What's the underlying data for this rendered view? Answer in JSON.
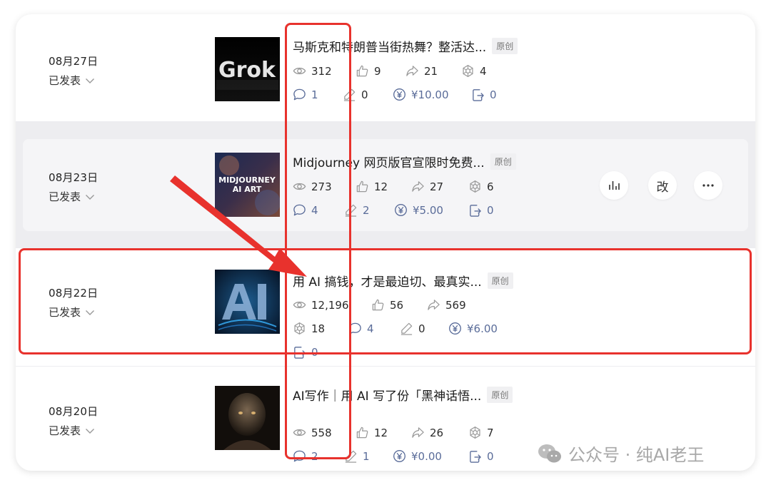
{
  "articles": [
    {
      "date": "08月27日",
      "status": "已发表",
      "title": "马斯克和特朗普当街热舞？整活达...",
      "tag": "原创",
      "thumb_text": "Grok",
      "reads": "312",
      "likes": "9",
      "shares": "21",
      "recommends": "4",
      "comments": "1",
      "notes": "0",
      "earnings": "¥10.00",
      "jumps": "0"
    },
    {
      "date": "08月23日",
      "status": "已发表",
      "title": "Midjourney 网页版官宣限时免费...",
      "tag": "原创",
      "thumb_text_1": "MIDJOURNEY",
      "thumb_text_2": "AI ART",
      "reads": "273",
      "likes": "12",
      "shares": "27",
      "recommends": "6",
      "comments": "4",
      "notes": "2",
      "earnings": "¥5.00",
      "jumps": "0"
    },
    {
      "date": "08月22日",
      "status": "已发表",
      "title": "用 AI 搞钱，才是最迫切、最真实...",
      "tag": "原创",
      "reads": "12,196",
      "likes": "56",
      "shares": "569",
      "recommends": "18",
      "comments": "4",
      "notes": "0",
      "earnings": "¥6.00",
      "jumps": "0"
    },
    {
      "date": "08月20日",
      "status": "已发表",
      "title": "AI写作｜用 AI 写了份「黑神话悟...",
      "tag": "原创",
      "reads": "558",
      "likes": "12",
      "shares": "26",
      "recommends": "7",
      "comments": "2",
      "notes": "1",
      "earnings": "¥0.00",
      "jumps": "0"
    }
  ],
  "row_actions": {
    "edit_label": "改"
  },
  "watermark": {
    "text": "公众号 · 纯AI老王"
  },
  "colors": {
    "highlight": "#e8322d",
    "metric_blue": "#5a6c99"
  },
  "icons": [
    "eye-icon",
    "thumbs-up-icon",
    "share-icon",
    "recommend-icon",
    "comment-icon",
    "pen-icon",
    "yuan-icon",
    "jump-icon",
    "chevron-down-icon",
    "stats-icon",
    "more-icon",
    "wechat-icon"
  ]
}
